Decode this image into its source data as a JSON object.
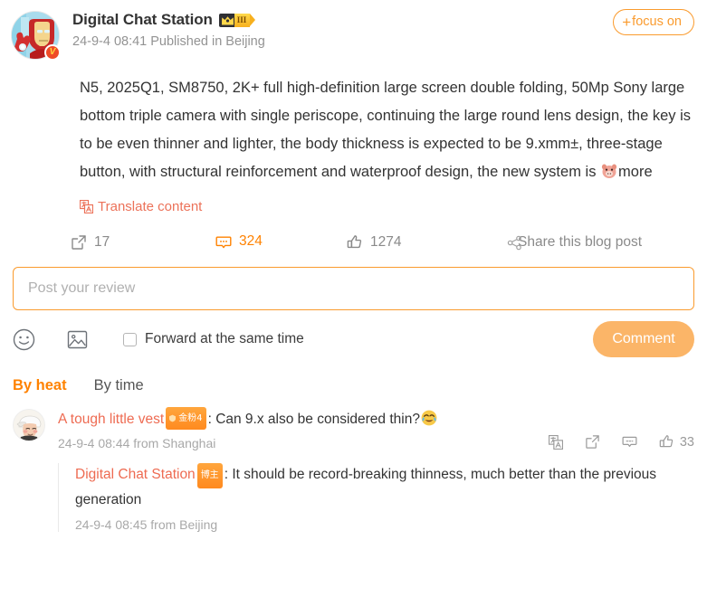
{
  "post": {
    "author": "Digital Chat Station",
    "vip_level_label": "III",
    "vip_icon": "crown-icon",
    "verified_icon": "verified-v-badge",
    "meta": "24-9-4 08:41 Published in Beijing",
    "follow_button": {
      "plus": "+",
      "label": "focus on"
    },
    "content": "N5, 2025Q1, SM8750, 2K+ full high-definition large screen double folding, 50Mp Sony large bottom triple camera with single periscope, continuing the large round lens design, the key is to be even thinner and lighter, the body thickness is expected to be 9.xmm±, three-stage button, with structural reinforcement and waterproof design, the new system is ",
    "content_tail": "more",
    "content_emoji": "pig-face-emoji",
    "translate_label": "Translate content",
    "translate_icon": "translate-icon"
  },
  "actions": {
    "repost": {
      "icon": "repost-icon",
      "count": "17"
    },
    "comment": {
      "icon": "comment-bubble-icon",
      "count": "324"
    },
    "like": {
      "icon": "thumbs-up-icon",
      "count": "1274"
    },
    "share": {
      "icon": "share-nodes-icon",
      "label": "Share this blog post"
    }
  },
  "composer": {
    "placeholder": "Post your review",
    "value": "",
    "emoji_icon": "smiley-face-icon",
    "image_icon": "picture-icon",
    "forward_label": "Forward at the same time",
    "forward_checked": false,
    "submit_label": "Comment"
  },
  "sort": {
    "tabs": [
      {
        "label": "By heat",
        "active": true
      },
      {
        "label": "By time",
        "active": false
      }
    ]
  },
  "comments": [
    {
      "user": "A tough little vest",
      "badge": "金粉4",
      "badge_type": "fan-badge",
      "separator": ": ",
      "text": "Can 9.x also be considered thin?",
      "emoji": "laughing-tears-emoji",
      "meta": "24-9-4 08:44 from Shanghai",
      "actions": {
        "translate_icon": "translate-icon",
        "repost_icon": "repost-icon",
        "comment_icon": "comment-bubble-icon",
        "like_icon": "thumbs-up-icon",
        "like_count": "33"
      },
      "reply": {
        "user": "Digital Chat Station",
        "badge": "博主",
        "badge_type": "author-badge",
        "separator": ": ",
        "text": "It should be record-breaking thinness, much better than the previous generation",
        "meta": "24-9-4 08:45 from Beijing"
      }
    }
  ],
  "colors": {
    "accent_orange": "#ff8200",
    "button_orange": "#fa9b2e",
    "submit_orange": "#fbb568",
    "username_red": "#ee6b52",
    "translate_coral": "#ec7259",
    "muted_gray": "#8a8a8a"
  }
}
